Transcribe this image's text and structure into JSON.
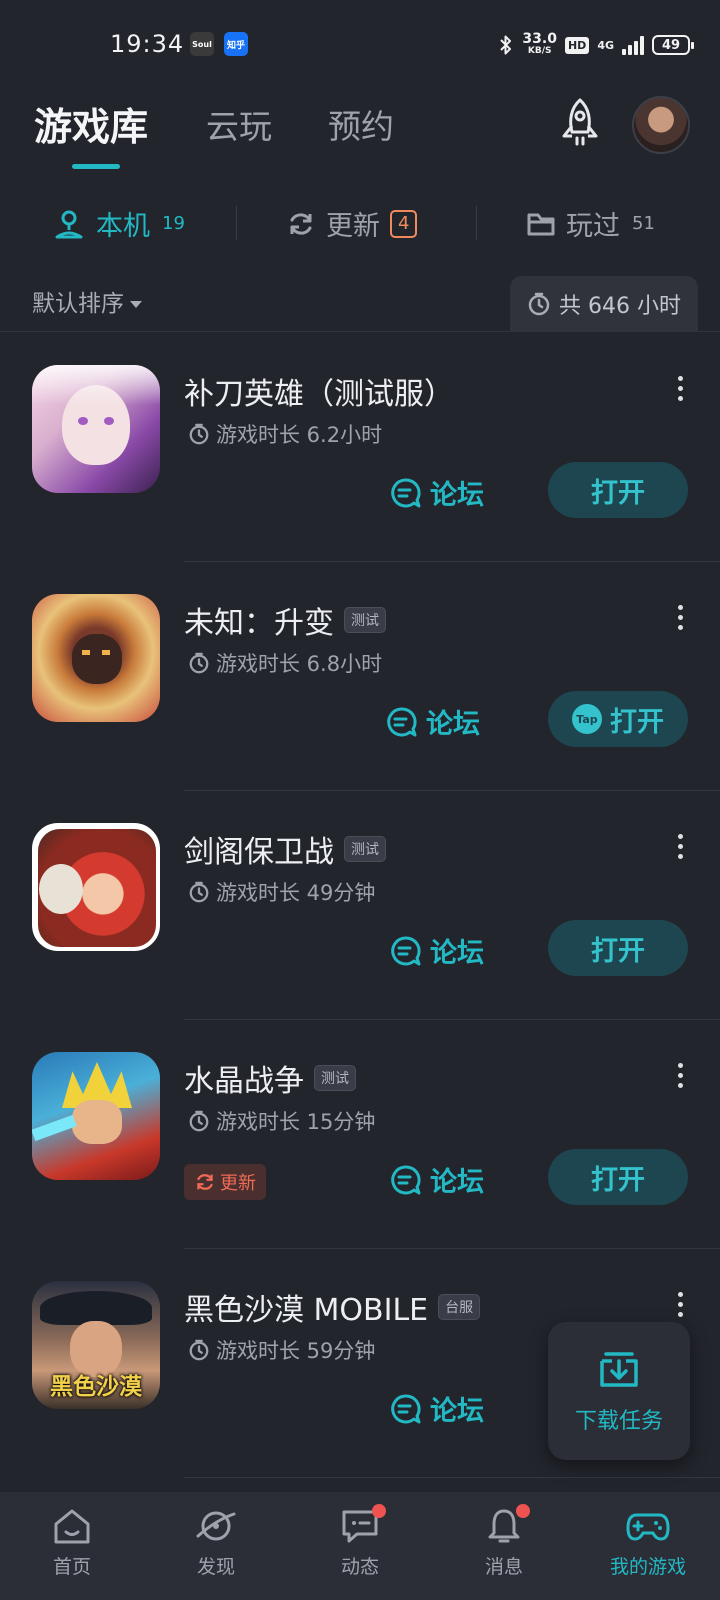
{
  "status_bar": {
    "time": "19:34",
    "apps": [
      "Soul",
      "知乎"
    ],
    "net_speed_value": "33.0",
    "net_speed_unit": "KB/S",
    "hd": "HD",
    "network": "4G",
    "battery": "49"
  },
  "header": {
    "tabs": [
      {
        "label": "游戏库",
        "active": true
      },
      {
        "label": "云玩",
        "active": false
      },
      {
        "label": "预约",
        "active": false
      }
    ],
    "rocket_icon": "rocket-icon",
    "avatar_icon": "user-avatar"
  },
  "subtabs": [
    {
      "label": "本机",
      "count": "19",
      "icon": "device-icon",
      "active": true
    },
    {
      "label": "更新",
      "badge": "4",
      "icon": "refresh-icon",
      "active": false
    },
    {
      "label": "玩过",
      "count": "51",
      "icon": "folder-icon",
      "active": false
    }
  ],
  "sort": {
    "label": "默认排序",
    "total_label": "共 646 小时"
  },
  "games": [
    {
      "title": "补刀英雄（测试服）",
      "tag": "",
      "playtime": "游戏时长 6.2小时",
      "forum_label": "论坛",
      "open_label": "打开",
      "open_icon": "",
      "update_label": ""
    },
    {
      "title": "未知：升变",
      "tag": "测试",
      "playtime": "游戏时长 6.8小时",
      "forum_label": "论坛",
      "open_label": "打开",
      "open_icon": "Tap",
      "update_label": ""
    },
    {
      "title": "剑阁保卫战",
      "tag": "测试",
      "playtime": "游戏时长 49分钟",
      "forum_label": "论坛",
      "open_label": "打开",
      "open_icon": "",
      "update_label": ""
    },
    {
      "title": "水晶战争",
      "tag": "测试",
      "playtime": "游戏时长 15分钟",
      "forum_label": "论坛",
      "open_label": "打开",
      "open_icon": "",
      "update_label": "更新"
    },
    {
      "title": "黑色沙漠 MOBILE",
      "tag": "台服",
      "playtime": "游戏时长 59分钟",
      "forum_label": "论坛",
      "open_label": "",
      "open_icon": "",
      "update_label": "",
      "icon_text": "黑色沙漠"
    }
  ],
  "download_fab": {
    "label": "下载任务"
  },
  "bottom_nav": [
    {
      "label": "首页",
      "icon": "home-icon",
      "dot": false,
      "active": false
    },
    {
      "label": "发现",
      "icon": "discover-icon",
      "dot": false,
      "active": false
    },
    {
      "label": "动态",
      "icon": "chat-icon",
      "dot": true,
      "active": false
    },
    {
      "label": "消息",
      "icon": "bell-icon",
      "dot": true,
      "active": false
    },
    {
      "label": "我的游戏",
      "icon": "gamepad-icon",
      "dot": false,
      "active": true
    }
  ],
  "colors": {
    "background": "#23252d",
    "accent": "#22b8c4",
    "open_button_bg": "#1d4650",
    "update_orange": "#f08a5d",
    "badge_red": "#ef5350"
  }
}
